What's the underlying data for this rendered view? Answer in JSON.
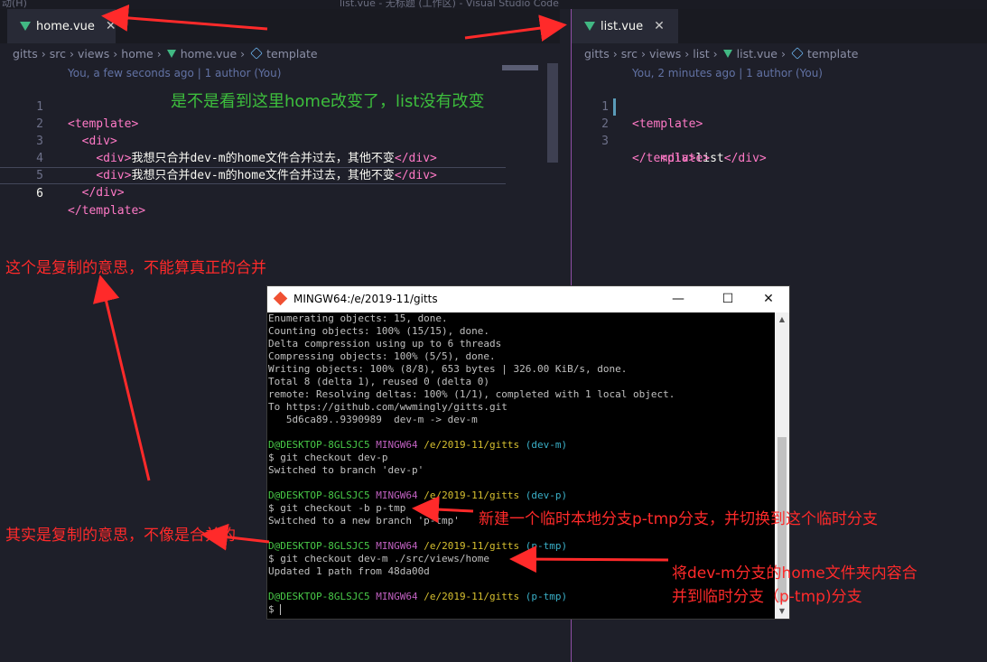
{
  "window": {
    "title_fragment_left": "动(H)",
    "title_fragment_center": "list.vue - 无标题 (工作区) - Visual Studio Code"
  },
  "left_editor": {
    "tab": {
      "label": "home.vue",
      "close": "✕"
    },
    "breadcrumb": [
      "gitts",
      "src",
      "views",
      "home",
      "home.vue",
      "template"
    ],
    "blame": "You, a few seconds ago | 1 author (You)",
    "lines": [
      {
        "n": "1",
        "indent": "",
        "open": "<template>",
        "text": "",
        "close": ""
      },
      {
        "n": "2",
        "indent": "  ",
        "open": "<div>",
        "text": "",
        "close": ""
      },
      {
        "n": "3",
        "indent": "    ",
        "open": "<div>",
        "text": "我想只合并dev-m的home文件合并过去，其他不变",
        "close": "</div>"
      },
      {
        "n": "4",
        "indent": "    ",
        "open": "<div>",
        "text": "我想只合并dev-m的home文件合并过去，其他不变",
        "close": "</div>"
      },
      {
        "n": "5",
        "indent": "  ",
        "open": "</div>",
        "text": "",
        "close": ""
      },
      {
        "n": "6",
        "indent": "",
        "open": "</template>",
        "text": "",
        "close": ""
      }
    ]
  },
  "right_editor": {
    "tab": {
      "label": "list.vue",
      "close": "✕"
    },
    "breadcrumb": [
      "gitts",
      "src",
      "views",
      "list",
      "list.vue",
      "template"
    ],
    "blame": "You, 2 minutes ago | 1 author (You)",
    "lines": [
      {
        "n": "1",
        "indent": "",
        "open": "<template>",
        "text": "",
        "close": ""
      },
      {
        "n": "2",
        "indent": "    ",
        "open": "<div>",
        "text": "list",
        "close": "</div>"
      },
      {
        "n": "3",
        "indent": "",
        "open": "</template>",
        "text": "",
        "close": ""
      }
    ]
  },
  "terminal": {
    "title": "MINGW64:/e/2019-11/gitts",
    "buttons": {
      "minimize": "—",
      "maximize": "☐",
      "close": "✕"
    },
    "output": [
      "Enumerating objects: 15, done.",
      "Counting objects: 100% (15/15), done.",
      "Delta compression using up to 6 threads",
      "Compressing objects: 100% (5/5), done.",
      "Writing objects: 100% (8/8), 653 bytes | 326.00 KiB/s, done.",
      "Total 8 (delta 1), reused 0 (delta 0)",
      "remote: Resolving deltas: 100% (1/1), completed with 1 local object.",
      "To https://github.com/wwmingly/gitts.git",
      "   5d6ca89..9390989  dev-m -> dev-m"
    ],
    "prompt_user": "D@DESKTOP-8GLSJC5",
    "prompt_sys": "MINGW64",
    "prompt_path": "/e/2019-11/gitts",
    "blocks": [
      {
        "branch": "(dev-m)",
        "cmd": "$ git checkout dev-p",
        "result": "Switched to branch 'dev-p'"
      },
      {
        "branch": "(dev-p)",
        "cmd": "$ git checkout -b p-tmp",
        "result": "Switched to a new branch 'p-tmp'"
      },
      {
        "branch": "(p-tmp)",
        "cmd": "$ git checkout dev-m ./src/views/home",
        "result": "Updated 1 path from 48da00d"
      },
      {
        "branch": "(p-tmp)",
        "cmd": "$ ",
        "result": ""
      }
    ]
  },
  "annotations": {
    "green_note": "是不是看到这里home改变了，list没有改变",
    "copy_note": "这个是复制的意思，不能算真正的合并",
    "copy_note2": "其实是复制的意思，不像是合并的",
    "new_branch_note": "新建一个临时本地分支p-tmp分支，并切换到这个临时分支",
    "merge_note_1": "将dev-m分支的home文件夹内容合",
    "merge_note_2": "并到临时分支（p-tmp)分支"
  },
  "colors": {
    "annotation_red": "#ff2a2a",
    "annotation_green": "#3dbe3d",
    "tag_pink": "#ff79c6",
    "pane_divider": "#8f4ea5"
  }
}
